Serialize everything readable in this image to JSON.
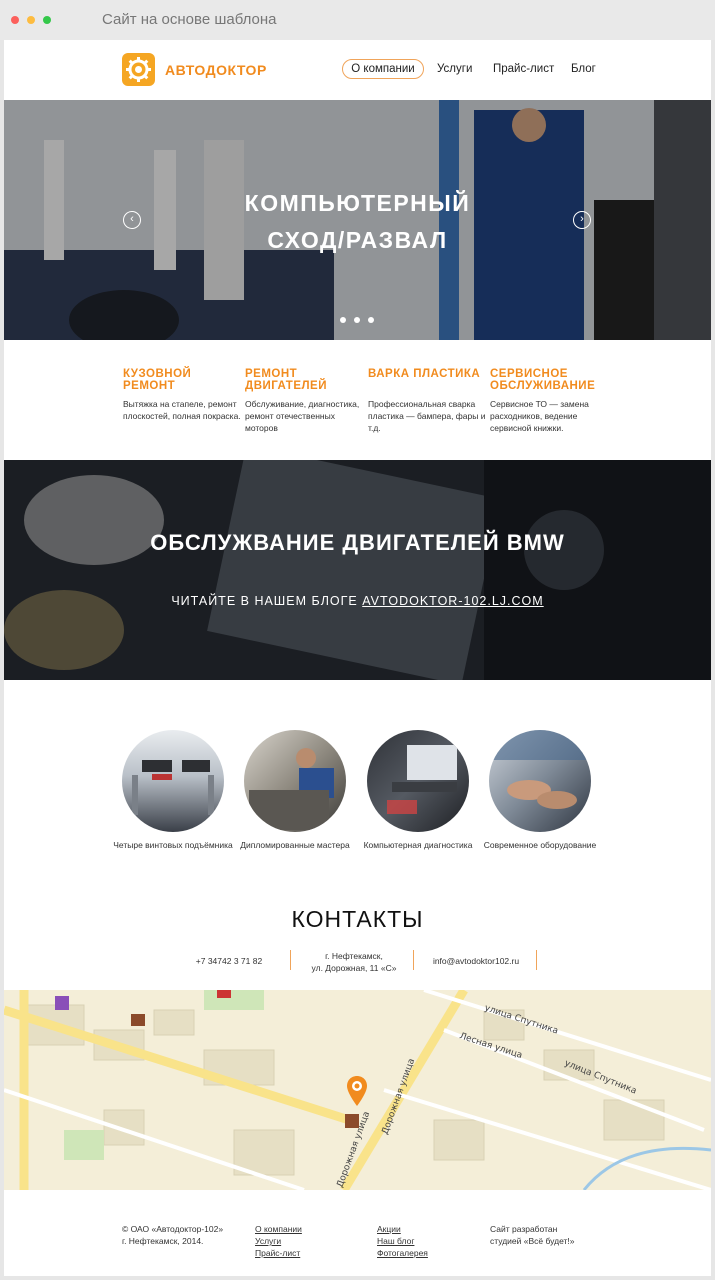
{
  "browser": {
    "title": "Сайт на основе шаблона",
    "dot_colors": [
      "#fc605c",
      "#fdbc40",
      "#34c84a"
    ]
  },
  "header": {
    "logo_text": "АВТОДОКТОР",
    "nav": [
      "О компании",
      "Услуги",
      "Прайс-лист",
      "Блог"
    ],
    "active_index": 0
  },
  "hero": {
    "title_line1": "КОМПЬЮТЕРНЫЙ",
    "title_line2": "СХОД/РАЗВАЛ",
    "prev_icon": "arrow-left-icon",
    "next_icon": "arrow-right-icon",
    "slides": 3
  },
  "services": [
    {
      "title": "Кузовной ремонт",
      "desc": "Вытяжка на стапеле, ремонт плоскостей, полная покраска."
    },
    {
      "title": "Ремонт двигателей",
      "desc": "Обслуживание, диагностика, ремонт отечественных моторов"
    },
    {
      "title": "Варка пластика",
      "desc": "Профессиональная сварка пластика — бампера, фары и т.д."
    },
    {
      "title": "Сервисное обслуживание",
      "desc": "Сервисное ТО — замена расходников, ведение сервисной книжки."
    }
  ],
  "banner": {
    "title": "ОБСЛУЖВАНИЕ ДВИГАТЕЛЕЙ BMW",
    "subtitle_prefix": "ЧИТАЙТЕ В НАШЕМ БЛОГЕ ",
    "subtitle_link": "AVTODOKTOR-102.LJ.COM"
  },
  "features": [
    {
      "caption": "Четыре винтовых подъёмника"
    },
    {
      "caption": "Дипломированные мастера"
    },
    {
      "caption": "Компьютерная диагностика"
    },
    {
      "caption": "Современное оборудование"
    }
  ],
  "contacts": {
    "title": "КОНТАКТЫ",
    "phone": "+7 34742 3 71 82",
    "address_line1": "г. Нефтекамск,",
    "address_line2": "ул. Дорожная, 11 «С»",
    "email": "info@avtodoktor102.ru"
  },
  "map": {
    "labels": [
      "улица Спутника",
      "Лесная улица",
      "улица Спутника",
      "Дорожная улица",
      "Дорожная улица"
    ],
    "pin_icon": "map-pin-icon"
  },
  "footer": {
    "copyright_line1": "© ОАО «Автодоктор-102»",
    "copyright_line2": "г. Нефтекамск, 2014.",
    "col1": [
      "О компании",
      "Услуги",
      "Прайс-лист"
    ],
    "col2": [
      "Акции",
      "Наш блог",
      "Фотогалерея"
    ],
    "credit_line1": "Сайт разработан",
    "credit_line2": "студией «Всё будет!»"
  },
  "colors": {
    "accent": "#f18b1e",
    "logo_bg": "#f5a623"
  }
}
